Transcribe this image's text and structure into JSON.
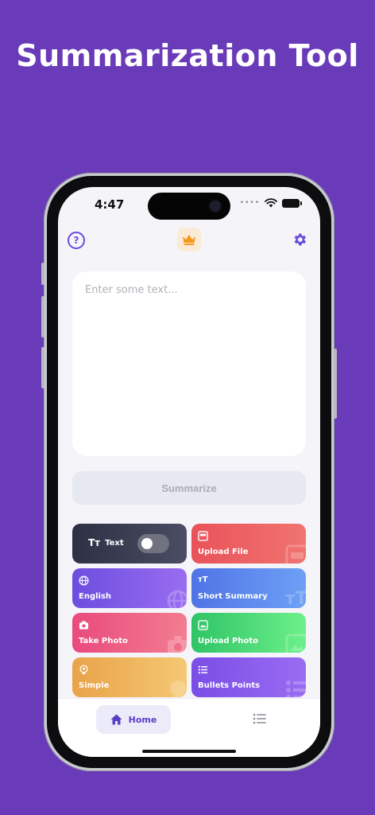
{
  "headline": "Summarization Tool",
  "status_bar": {
    "time": "4:47"
  },
  "input": {
    "placeholder": "Enter some text..."
  },
  "summarize_button": {
    "label": "Summarize"
  },
  "tiles": {
    "text": {
      "label": "Text",
      "toggle_on": false
    },
    "upload_file": {
      "label": "Upload File"
    },
    "english": {
      "label": "English"
    },
    "short_summary": {
      "label": "Short Summary"
    },
    "take_photo": {
      "label": "Take Photo"
    },
    "upload_photo": {
      "label": "Upload Photo"
    },
    "simple": {
      "label": "Simple"
    },
    "bullets": {
      "label": "Bullets Points"
    }
  },
  "tabbar": {
    "home_label": "Home"
  },
  "colors": {
    "background": "#6a3bb8",
    "accent": "#6a4cd8",
    "crown": "#f29a1a"
  }
}
